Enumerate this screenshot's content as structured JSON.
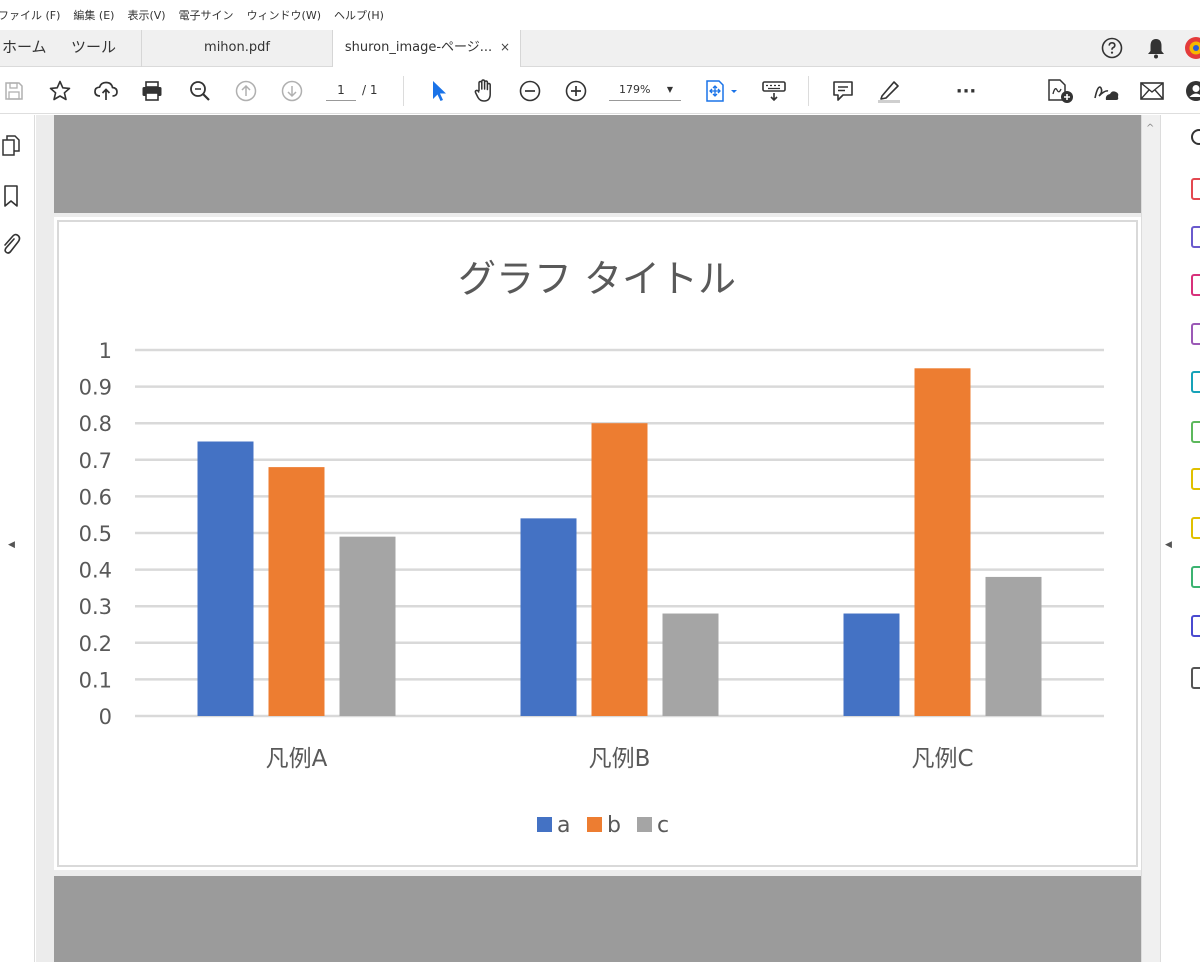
{
  "menu": [
    "ファイル (F)",
    "編集 (E)",
    "表示(V)",
    "電子サイン",
    "ウィンドウ(W)",
    "ヘルプ(H)"
  ],
  "tabs": {
    "home": "ホーム",
    "tools": "ツール",
    "documents": [
      {
        "label": "mihon.pdf",
        "active": false
      },
      {
        "label": "shuron_image-ページ...",
        "active": true
      }
    ],
    "close_glyph": "×"
  },
  "toolbar": {
    "page_current": "1",
    "page_total": "/ 1",
    "zoom": "179%",
    "more": "···",
    "colors": {
      "accent": "#1a73e8",
      "icon": "#333333",
      "disabled": "#b0b0b0"
    }
  },
  "icons": {
    "toolbar": [
      "save-icon",
      "star-icon",
      "cloud-upload-icon",
      "print-icon",
      "search-icon",
      "page-up-icon",
      "page-down-icon",
      "select-pointer-icon",
      "hand-icon",
      "zoom-out-icon",
      "zoom-in-icon",
      "fit-page-icon",
      "keyboard-scroll-icon",
      "comment-icon",
      "highlight-pen-icon",
      "more-icon",
      "create-pdf-icon",
      "sign-icon",
      "mail-icon",
      "account-icon"
    ],
    "left_nav": [
      "page-thumbnails-icon",
      "bookmark-icon",
      "attachment-icon"
    ]
  },
  "right_panel_colors": [
    "#e34850",
    "#6a5acd",
    "#d8317b",
    "#9b59b6",
    "#17a2b8",
    "#5cb85c",
    "#e0c000",
    "#e0c000",
    "#3cb371",
    "#4a4ad0",
    "#555555"
  ],
  "chart_data": {
    "type": "bar",
    "title": "グラフ タイトル",
    "categories": [
      "凡例A",
      "凡例B",
      "凡例C"
    ],
    "series": [
      {
        "name": "a",
        "color": "#4472c4",
        "values": [
          0.75,
          0.54,
          0.28
        ]
      },
      {
        "name": "b",
        "color": "#ed7d31",
        "values": [
          0.68,
          0.8,
          0.95
        ]
      },
      {
        "name": "c",
        "color": "#a5a5a5",
        "values": [
          0.49,
          0.28,
          0.38
        ]
      }
    ],
    "yticks": [
      "0",
      "0.1",
      "0.2",
      "0.3",
      "0.4",
      "0.5",
      "0.6",
      "0.7",
      "0.8",
      "0.9",
      "1"
    ],
    "ylim": [
      0,
      1
    ],
    "grid": true,
    "legend": "bottom"
  }
}
